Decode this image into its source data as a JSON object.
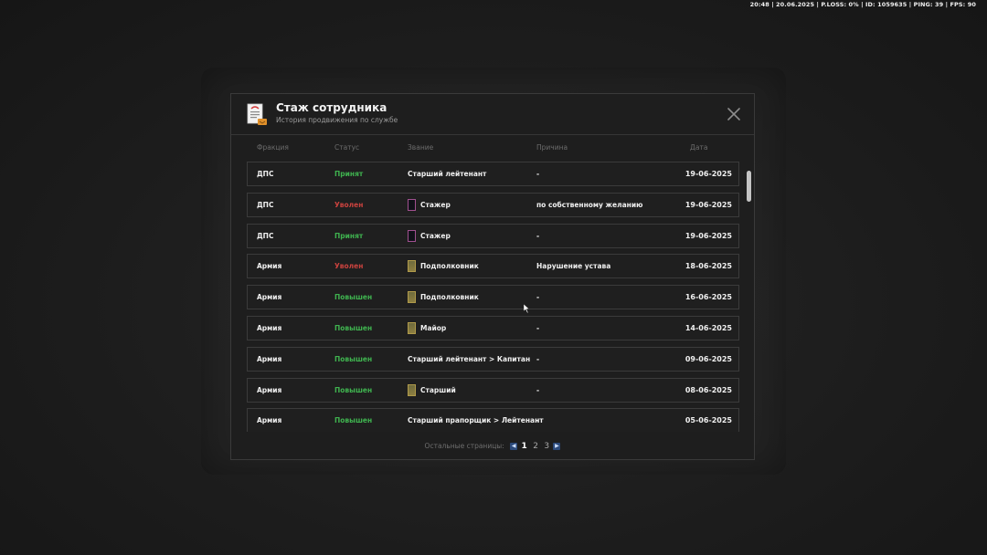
{
  "hud": {
    "text": "20:48 | 20.06.2025 | P.LOSS: 0% | ID: 1059635 | PING: 39 | FPS: 90"
  },
  "modal": {
    "title": "Стаж сотрудника",
    "subtitle": "История продвижения по службе",
    "icon": "document-icon",
    "close_icon": "close-icon"
  },
  "columns": {
    "faction": "Фракция",
    "status": "Статус",
    "rank": "Звание",
    "reason": "Причина",
    "date": "Дата"
  },
  "rows": [
    {
      "faction": "ДПС",
      "status": "Принят",
      "status_color": "#3fb34f",
      "rank_icon": "none",
      "rank": "Старший лейтенант",
      "reason": "-",
      "date": "19-06-2025"
    },
    {
      "faction": "ДПС",
      "status": "Уволен",
      "status_color": "#c9423e",
      "rank_icon": "dark",
      "rank": "Стажер",
      "reason": "по собственному желанию",
      "date": "19-06-2025"
    },
    {
      "faction": "ДПС",
      "status": "Принят",
      "status_color": "#3fb34f",
      "rank_icon": "dark",
      "rank": "Стажер",
      "reason": "-",
      "date": "19-06-2025"
    },
    {
      "faction": "Армия",
      "status": "Уволен",
      "status_color": "#c9423e",
      "rank_icon": "gold",
      "rank": "Подполковник",
      "reason": "Нарушение устава",
      "date": "18-06-2025"
    },
    {
      "faction": "Армия",
      "status": "Повышен",
      "status_color": "#3fb34f",
      "rank_icon": "gold",
      "rank": "Подполковник",
      "reason": "-",
      "date": "16-06-2025"
    },
    {
      "faction": "Армия",
      "status": "Повышен",
      "status_color": "#3fb34f",
      "rank_icon": "gold",
      "rank": "Майор",
      "reason": "-",
      "date": "14-06-2025"
    },
    {
      "faction": "Армия",
      "status": "Повышен",
      "status_color": "#3fb34f",
      "rank_icon": "none",
      "rank": "Старший лейтенант > Капитан",
      "reason": "-",
      "date": "09-06-2025"
    },
    {
      "faction": "Армия",
      "status": "Повышен",
      "status_color": "#3fb34f",
      "rank_icon": "gold",
      "rank": "Старший",
      "reason": "-",
      "date": "08-06-2025"
    },
    {
      "faction": "Армия",
      "status": "Повышен",
      "status_color": "#3fb34f",
      "rank_icon": "none",
      "rank": "Старший прапорщик > Лейтенант",
      "reason": "-",
      "date": "05-06-2025"
    }
  ],
  "pager": {
    "label": "Остальные страницы:",
    "prev_icon": "chevron-left-icon",
    "next_icon": "chevron-right-icon",
    "pages": [
      "1",
      "2",
      "3"
    ],
    "active_page": "1"
  },
  "colors": {
    "accent_green": "#3fb34f",
    "accent_red": "#c9423e",
    "pager_button": "#2c4a7a"
  }
}
